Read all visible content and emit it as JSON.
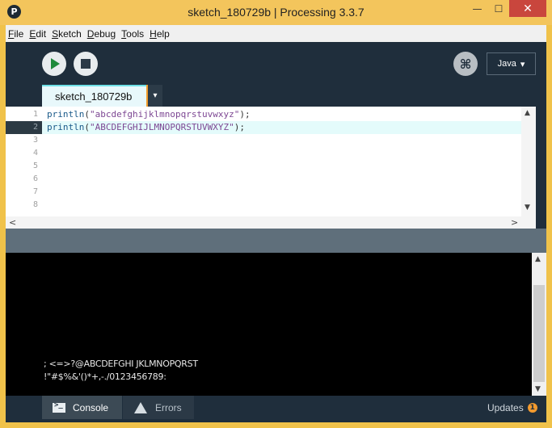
{
  "window": {
    "title": "sketch_180729b | Processing 3.3.7",
    "app_icon": "P",
    "min_glyph": "—",
    "max_glyph": "☐",
    "close_glyph": "✕"
  },
  "menubar": {
    "items": [
      "File",
      "Edit",
      "Sketch",
      "Debug",
      "Tools",
      "Help"
    ]
  },
  "toolbar": {
    "debug_glyph": "⌘",
    "mode_label": "Java",
    "mode_arrow": "▾"
  },
  "tabs": {
    "active_label": "sketch_180729b",
    "menu_glyph": "▾"
  },
  "editor": {
    "line_numbers": [
      "1",
      "2",
      "3",
      "4",
      "5",
      "6",
      "7",
      "8"
    ],
    "lines": [
      {
        "fn": "println",
        "open": "(",
        "str": "\"abcdefghijklmnopqrstuvwxyz\"",
        "close": ");"
      },
      {
        "fn": "println",
        "open": "(",
        "str": "\"ABCDEFGHIJLMNOPQRSTUVWXYZ\"",
        "close": ");"
      }
    ],
    "scroll_up": "▲",
    "scroll_down": "▼",
    "scroll_left": "<",
    "scroll_right": ">"
  },
  "console": {
    "lines": [
      "; <=>?@ABCDEFGHI JKLMNOPQRST",
      "!\"#$%&'()*+,-./0123456789:"
    ],
    "scroll_up": "▲",
    "scroll_down": "▼"
  },
  "footer": {
    "console_label": "Console",
    "errors_label": "Errors",
    "updates_label": "Updates",
    "updates_count": "1"
  }
}
